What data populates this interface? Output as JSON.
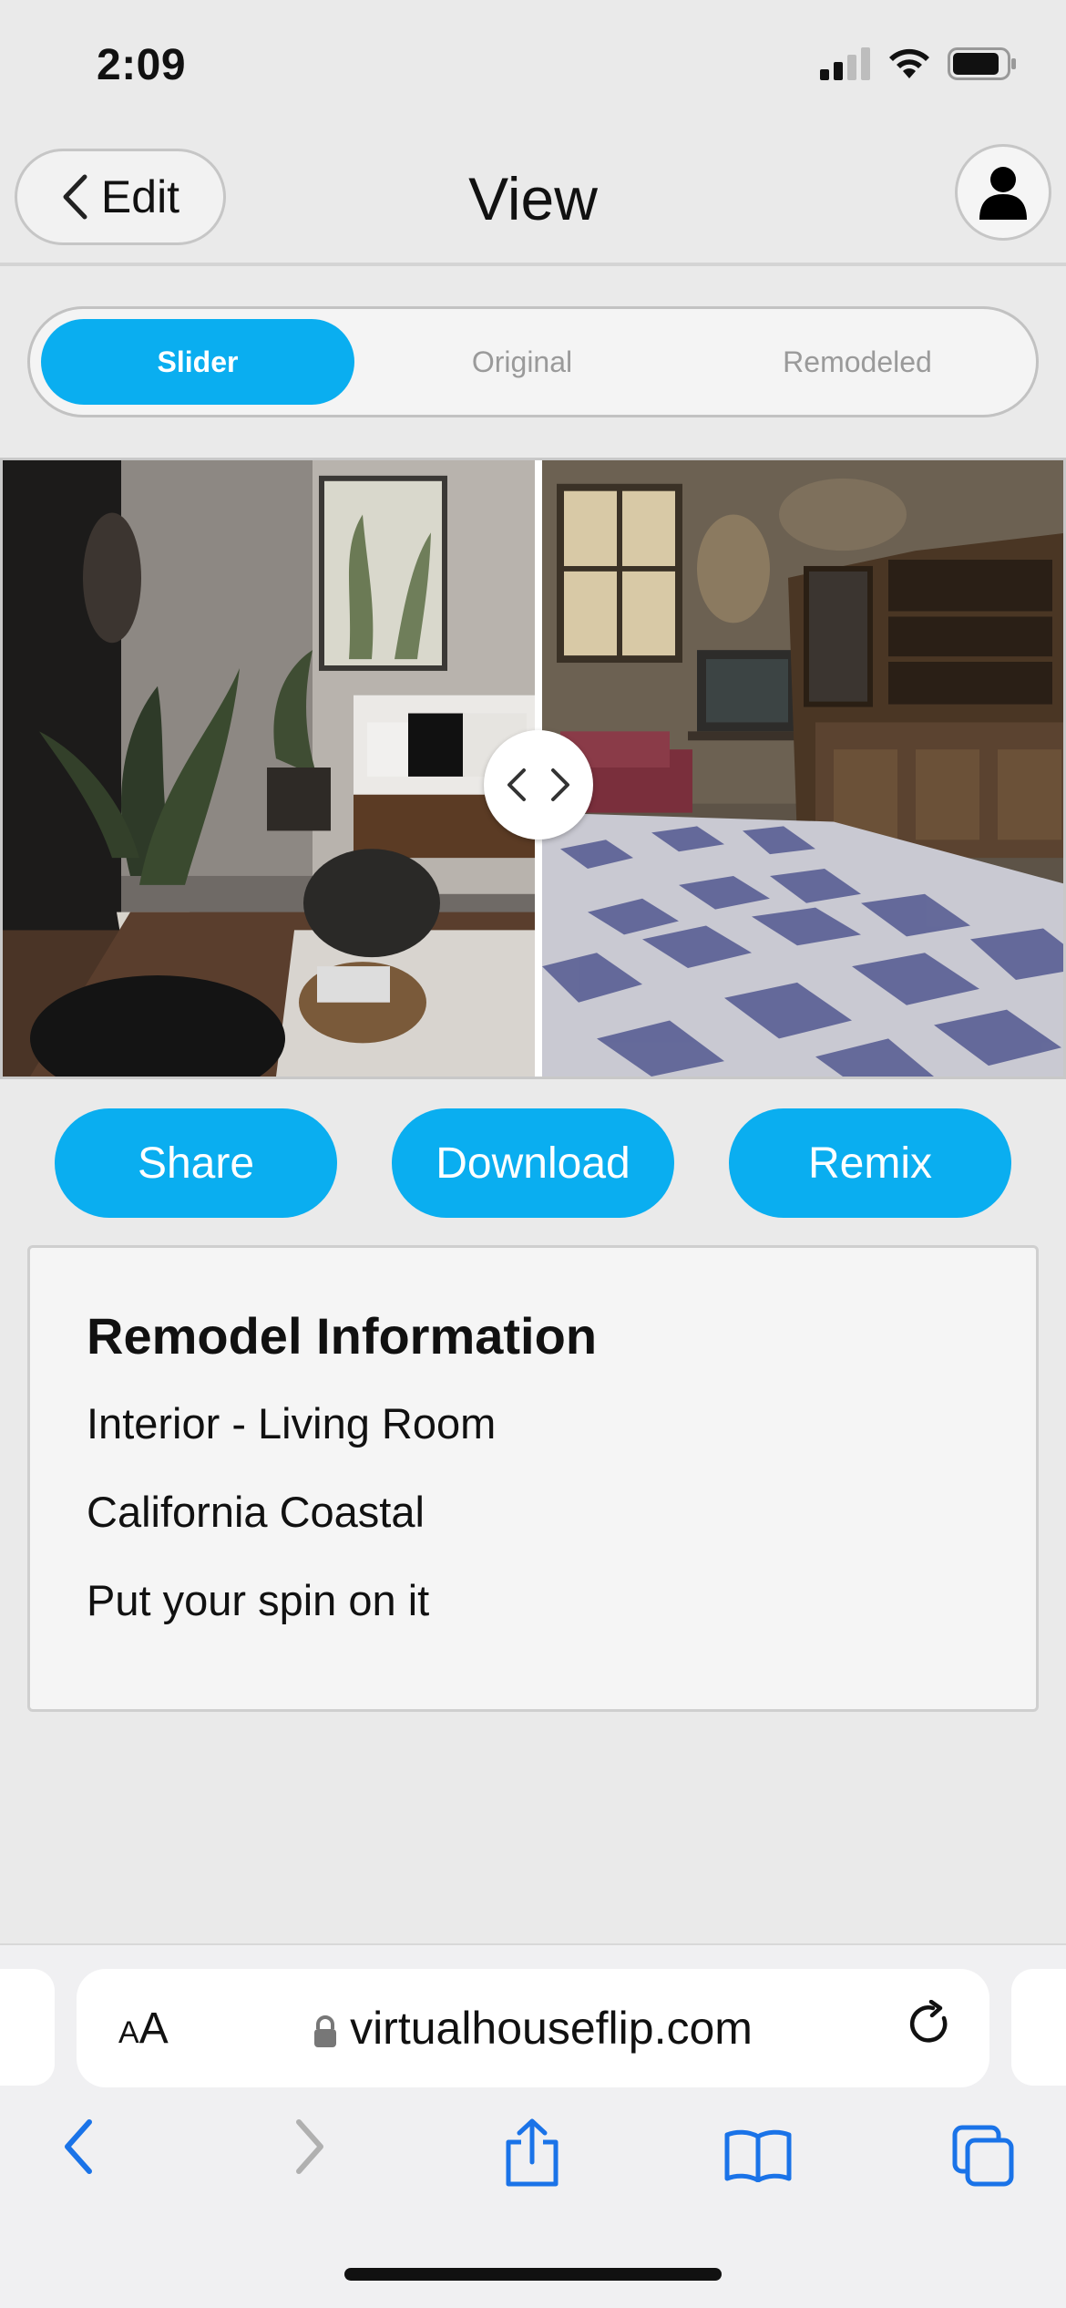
{
  "status_bar": {
    "time": "2:09",
    "icons": [
      "cellular-signal-icon",
      "wifi-icon",
      "battery-icon"
    ]
  },
  "header": {
    "back_label": "Edit",
    "title": "View",
    "profile_icon": "user-avatar-icon"
  },
  "view_modes": {
    "options": [
      "Slider",
      "Original",
      "Remodeled"
    ],
    "selected": "Slider"
  },
  "compare": {
    "left_image": "remodeled living room photo",
    "right_image": "original abandoned room photo",
    "slider_position_fraction": 0.5
  },
  "actions": {
    "share": "Share",
    "download": "Download",
    "remix": "Remix"
  },
  "info": {
    "title": "Remodel Information",
    "room": "Interior - Living Room",
    "style": "California Coastal",
    "prompt": "Put your spin on it"
  },
  "browser": {
    "text_size_label": "AA",
    "url": "virtualhouseflip.com",
    "toolbar_icons": [
      "back-icon",
      "forward-icon",
      "share-icon",
      "bookmarks-icon",
      "tabs-icon"
    ]
  },
  "colors": {
    "accent": "#0aaef0",
    "background": "#eaeaea",
    "browser_blue": "#1a73e8"
  }
}
